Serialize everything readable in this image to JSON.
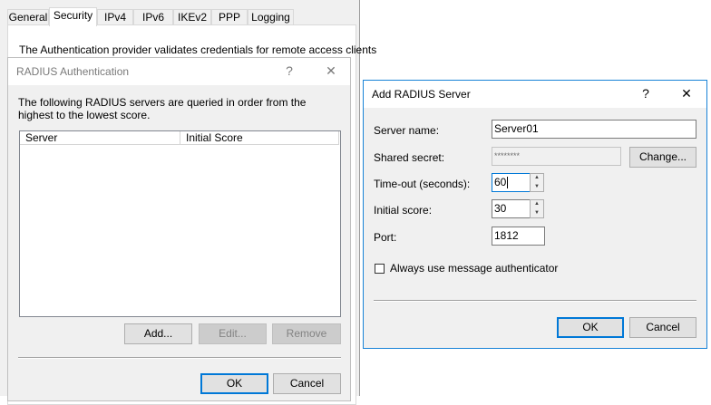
{
  "props": {
    "tabs": [
      "General",
      "Security",
      "IPv4",
      "IPv6",
      "IKEv2",
      "PPP",
      "Logging"
    ],
    "active_tab": "Security",
    "auth_text": "The Authentication provider validates credentials for remote access clients"
  },
  "radius": {
    "title": "RADIUS Authentication",
    "help_glyph": "?",
    "close_glyph": "✕",
    "description": "The following RADIUS servers are queried in order from the highest to the lowest score.",
    "columns": [
      "Server",
      "Initial Score"
    ],
    "add_label": "Add...",
    "edit_label": "Edit...",
    "remove_label": "Remove",
    "ok_label": "OK",
    "cancel_label": "Cancel"
  },
  "add_server": {
    "title": "Add RADIUS Server",
    "help_glyph": "?",
    "close_glyph": "✕",
    "server_name_label": "Server name:",
    "server_name_value": "Server01",
    "shared_secret_label": "Shared secret:",
    "shared_secret_value": "********",
    "change_label": "Change...",
    "timeout_label": "Time-out (seconds):",
    "timeout_value": "60",
    "initial_score_label": "Initial score:",
    "initial_score_value": "30",
    "port_label": "Port:",
    "port_value": "1812",
    "always_auth_label": "Always use message authenticator",
    "always_auth_checked": false,
    "ok_label": "OK",
    "cancel_label": "Cancel"
  }
}
